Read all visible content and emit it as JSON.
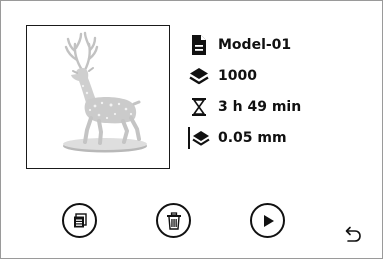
{
  "model": {
    "name": "Model-01",
    "layers": "1000",
    "print_time": "3 h 49 min",
    "layer_height": "0.05 mm"
  },
  "icons": {
    "name": "file-icon",
    "layers": "layers-icon",
    "time": "hourglass-icon",
    "layer_height": "layer-height-icon",
    "files_button": "file-list-icon",
    "delete_button": "trash-icon",
    "play_button": "play-icon",
    "back_button": "back-arrow-icon"
  },
  "colors": {
    "text": "#111111",
    "border": "#9a9a9a",
    "model_gray": "#c9c9c9"
  }
}
